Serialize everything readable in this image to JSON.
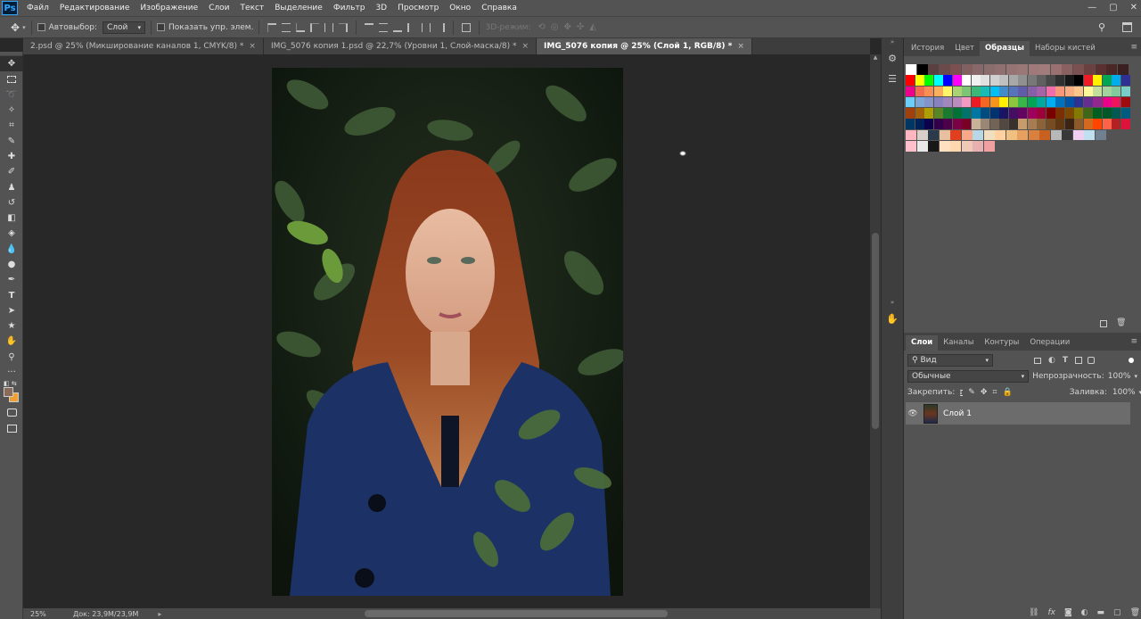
{
  "app": {
    "logo": "Ps",
    "window_controls": [
      "—",
      "▢",
      "✕"
    ]
  },
  "menu": [
    "Файл",
    "Редактирование",
    "Изображение",
    "Слои",
    "Текст",
    "Выделение",
    "Фильтр",
    "3D",
    "Просмотр",
    "Окно",
    "Справка"
  ],
  "options": {
    "autoselect_label": "Автовыбор:",
    "autoselect_value": "Слой",
    "show_transform_label": "Показать упр. элем.",
    "mode3d_label": "3D-режим:"
  },
  "tabs": [
    {
      "label": "2.psd @ 25% (Микширование каналов 1, CMYK/8) *",
      "active": false
    },
    {
      "label": "IMG_5076 копия 1.psd @ 22,7% (Уровни 1, Слой-маска/8) *",
      "active": false
    },
    {
      "label": "IMG_5076 копия @ 25% (Слой 1, RGB/8) *",
      "active": true
    }
  ],
  "status": {
    "zoom": "25%",
    "doc": "Док: 23,9M/23,9M"
  },
  "top_panel": {
    "tabs": [
      "История",
      "Цвет",
      "Образцы",
      "Наборы кистей"
    ],
    "active": "Образцы"
  },
  "layers_panel": {
    "tabs": [
      "Слои",
      "Каналы",
      "Контуры",
      "Операции"
    ],
    "active": "Слои",
    "filter_label": "Вид",
    "blend_mode": "Обычные",
    "opacity_label": "Непрозрачность:",
    "opacity_value": "100%",
    "lock_label": "Закрепить:",
    "fill_label": "Заливка:",
    "fill_value": "100%",
    "layer_name": "Слой 1"
  },
  "colors": {
    "accent": "#31a8ff",
    "foreground": "#8a6a5a",
    "background": "#f0a030"
  },
  "swatches": [
    [
      "#ffffff",
      "#000000",
      "#5a4040",
      "#6a4a4a",
      "#7a5050",
      "#806060",
      "#886868",
      "#8a6e6e",
      "#907070",
      "#967474",
      "#9a7878",
      "#a07a7a",
      "#a07c7c",
      "#9a7070",
      "#8a6060",
      "#7a5050",
      "#6a4040",
      "#5a3030",
      "#4a2828",
      "#3a2020"
    ],
    [
      "#ff0000",
      "#ffff00",
      "#00ff00",
      "#00ffff",
      "#0000ff",
      "#ff00ff",
      "#ffffff",
      "#f0f0f0",
      "#e0e0e0",
      "#d0d0d0",
      "#c0c0c0",
      "#a8a8a8",
      "#909090",
      "#787878",
      "#606060",
      "#484848",
      "#303030",
      "#181818",
      "#000000",
      "#ee1c24",
      "#fff200",
      "#00a651",
      "#00aeef",
      "#2e3192"
    ],
    [
      "#ec008c",
      "#f26c4f",
      "#f68e56",
      "#fbaf5d",
      "#fff568",
      "#acd373",
      "#7cc576",
      "#3bb878",
      "#1abbb4",
      "#00bff3",
      "#438ccb",
      "#5574b9",
      "#605ca8",
      "#855fa8",
      "#a763a8",
      "#f06ea9",
      "#f7977a",
      "#f9ad81",
      "#fdc68a",
      "#fff79a",
      "#c4df9b",
      "#a3d39c",
      "#82ca9d",
      "#7bcdc8"
    ],
    [
      "#6ecff6",
      "#7ea7d8",
      "#8493ca",
      "#8882be",
      "#a187be",
      "#bc8cbf",
      "#f49ac2",
      "#ed1c24",
      "#f26522",
      "#f7941d",
      "#fff200",
      "#8dc63f",
      "#39b54a",
      "#00a651",
      "#00a99d",
      "#00aeef",
      "#0072bc",
      "#0054a6",
      "#2e3192",
      "#662d91",
      "#92278f",
      "#ec008c",
      "#ed145b",
      "#9e0b0f"
    ],
    [
      "#a0410d",
      "#a36209",
      "#aba000",
      "#598527",
      "#1a7b30",
      "#007236",
      "#00746b",
      "#0076a3",
      "#004b80",
      "#003471",
      "#1b1464",
      "#440e62",
      "#630460",
      "#9e005d",
      "#9e0039",
      "#790000",
      "#7b2e00",
      "#7d4900",
      "#827b00",
      "#406618",
      "#005e20",
      "#005826",
      "#005952",
      "#005b7f"
    ],
    [
      "#003663",
      "#002157",
      "#0d004c",
      "#32004b",
      "#4b0049",
      "#7b0046",
      "#7a0026",
      "#c7b299",
      "#998675",
      "#736357",
      "#534741",
      "#37302d",
      "#c69c6d",
      "#a67c52",
      "#8c6239",
      "#754c24",
      "#603913",
      "#3c2415",
      "#8b5a2b",
      "#d2691e",
      "#ff4500",
      "#ff6347",
      "#b22222",
      "#dc143c"
    ],
    [
      "#ffb6c1",
      "#d8d0c8",
      "#2a3a4a",
      "#e8c0a0",
      "#e04020",
      "#f8a888",
      "#b8d8e8",
      "#f0e0c0",
      "#ffd0a0",
      "#f0c080",
      "#e8a060",
      "#d88040",
      "#c86020",
      "#b8b8b8",
      "#383838",
      "#f0d0f0",
      "#c0e0f0",
      "#708090"
    ],
    [
      "#ffc0cb",
      "#e8e8e8",
      "#181818",
      "#ffe0c0",
      "#ffd8b0",
      "#f0c8b8",
      "#e8b0b0",
      "#f0a0a0"
    ]
  ]
}
